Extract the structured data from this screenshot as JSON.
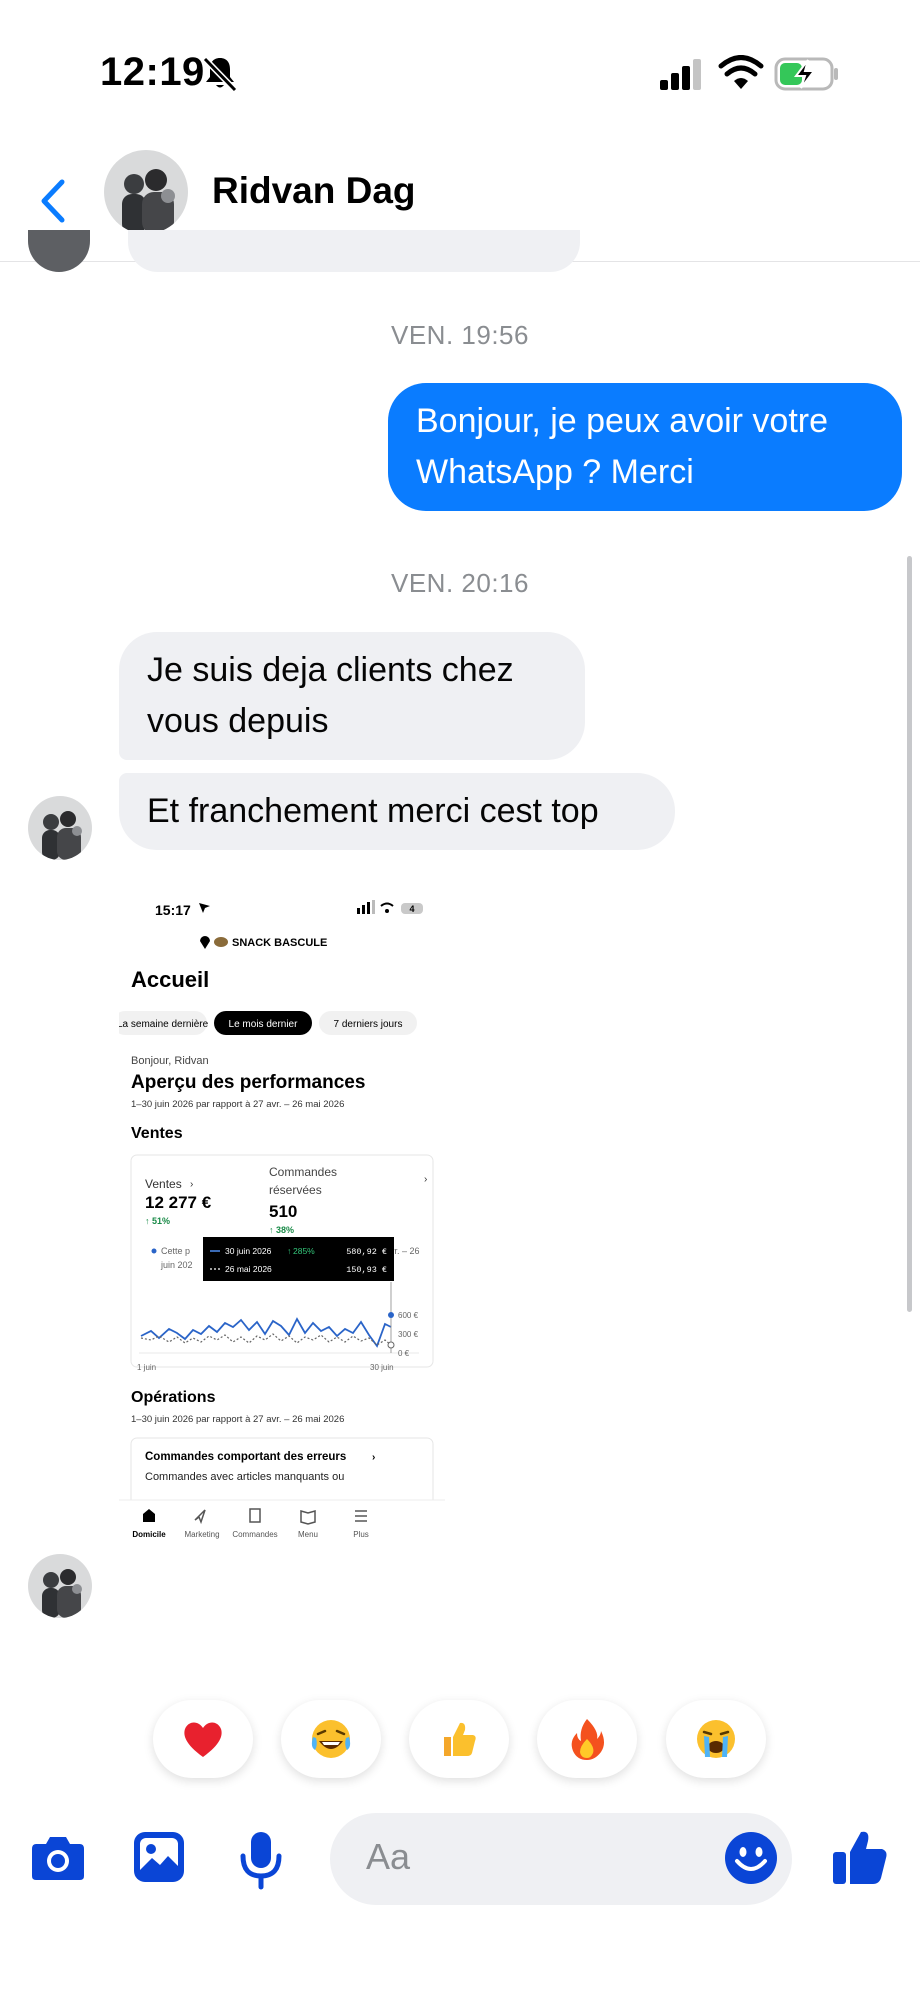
{
  "status_bar": {
    "time": "12:19"
  },
  "header": {
    "contact_name": "Ridvan Dag"
  },
  "conversation": {
    "timestamp_1": "VEN. 19:56",
    "outgoing_message": "Bonjour, je peux avoir votre WhatsApp ? Merci",
    "timestamp_2": "VEN. 20:16",
    "incoming_message_1": "Je suis deja clients chez vous depuis",
    "incoming_message_2": "Et franchement merci cest top"
  },
  "shared_image": {
    "time": "15:17",
    "battery": "4",
    "store_name": "SNACK BASCULE",
    "title": "Accueil",
    "filters": [
      "La semaine dernière",
      "Le mois dernier",
      "7 derniers jours"
    ],
    "greeting": "Bonjour, Ridvan",
    "overview_title": "Aperçu des performances",
    "period": "1–30 juin 2026 par rapport à 27 avr. – 26 mai 2026",
    "sales_heading": "Ventes",
    "kpi_sales_label": "Ventes",
    "kpi_sales_value": "12 277 €",
    "kpi_sales_delta": "51%",
    "kpi_orders_label_1": "Commandes",
    "kpi_orders_label_2": "réservées",
    "kpi_orders_value": "510",
    "kpi_orders_delta": "38%",
    "legend_fragment_1": "Cette p",
    "legend_fragment_2": "juin 202",
    "legend_fragment_3": "vr. – 26",
    "tooltip_row1_date": "30 juin 2026",
    "tooltip_row1_delta": "285%",
    "tooltip_row1_value": "580,92 €",
    "tooltip_row2_date": "26 mai 2026",
    "tooltip_row2_value": "150,93 €",
    "y_ticks": [
      "600 €",
      "300 €",
      "0 €"
    ],
    "x_ticks": [
      "1 juin",
      "30 juin"
    ],
    "ops_heading": "Opérations",
    "ops_period": "1–30 juin 2026 par rapport à 27 avr. – 26 mai 2026",
    "ops_card_title": "Commandes comportant des erreurs",
    "ops_card_text": "Commandes avec articles manquants ou",
    "nav": [
      "Domicile",
      "Marketing",
      "Commandes",
      "Menu",
      "Plus"
    ]
  },
  "reactions": [
    "❤️",
    "😂",
    "👍",
    "🔥",
    "😭"
  ],
  "composer": {
    "placeholder": "Aa"
  },
  "colors": {
    "accent": "#0a7cff",
    "incoming_bubble": "#eff0f3",
    "composer_icons": "#0a45d6"
  }
}
